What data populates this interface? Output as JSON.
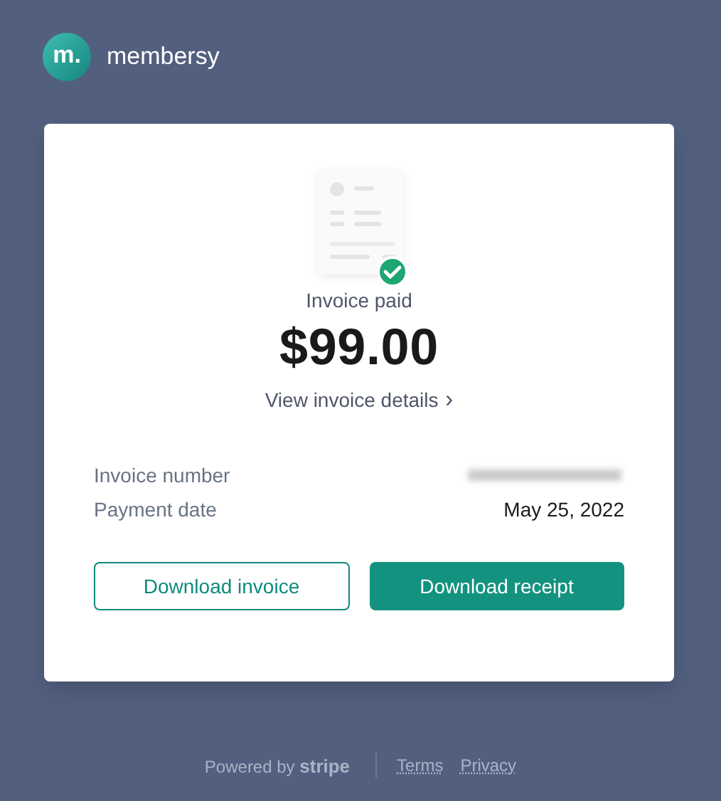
{
  "brand": {
    "logo_letter": "m.",
    "name": "membersy"
  },
  "invoice": {
    "status": "Invoice paid",
    "amount": "$99.00",
    "details_link": "View invoice details",
    "details_chevron": "›"
  },
  "fields": [
    {
      "label": "Invoice number",
      "kind": "redacted"
    },
    {
      "label": "Payment date",
      "kind": "text",
      "value": "May 25, 2022"
    }
  ],
  "buttons": [
    {
      "label": "Download invoice",
      "kind": "secondary"
    },
    {
      "label": "Download receipt",
      "kind": "primary"
    }
  ],
  "footer": {
    "powered_by": "Powered by",
    "provider": "stripe",
    "links": [
      "Terms",
      "Privacy"
    ]
  }
}
